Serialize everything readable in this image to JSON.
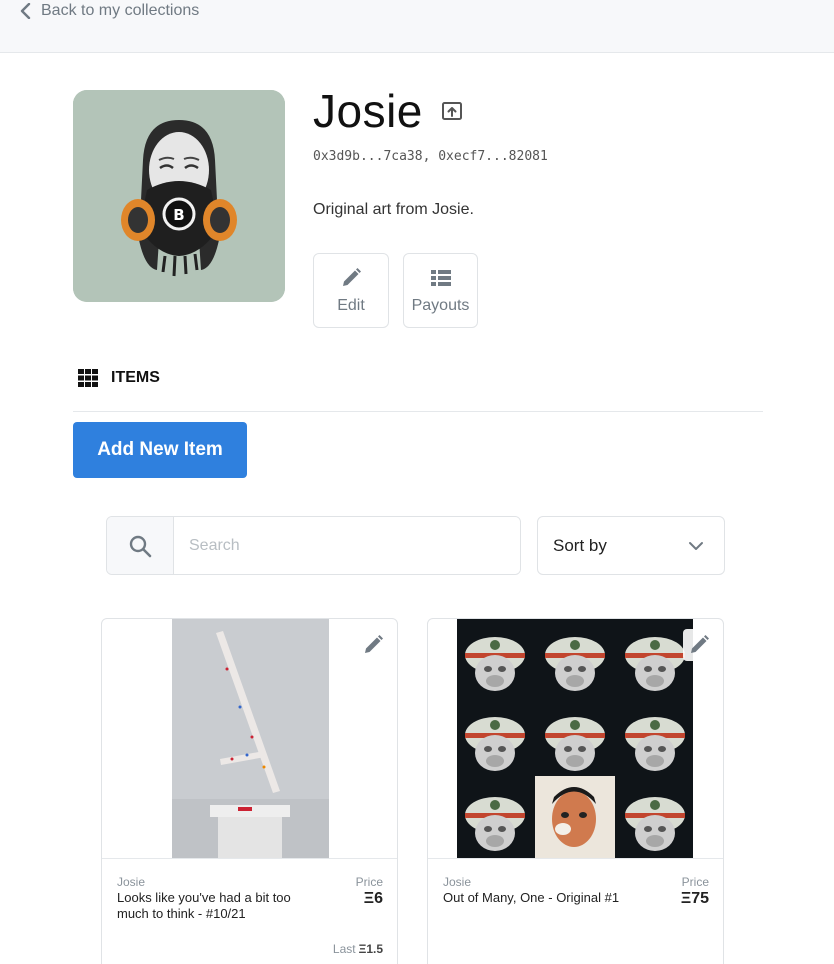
{
  "nav": {
    "back_label": "Back to my collections"
  },
  "collection": {
    "title": "Josie",
    "addresses": "0x3d9b...7ca38, 0xecf7...82081",
    "description": "Original art from Josie.",
    "actions": {
      "edit_label": "Edit",
      "payouts_label": "Payouts"
    }
  },
  "items_section": {
    "heading": "ITEMS",
    "add_button_label": "Add New Item"
  },
  "search": {
    "placeholder": "Search",
    "value": ""
  },
  "sort": {
    "label": "Sort by"
  },
  "cards": [
    {
      "creator": "Josie",
      "name": "Looks like you've had a bit too much to think - #10/21",
      "price_label": "Price",
      "price": "Ξ6",
      "last_label": "Last",
      "last_price": "Ξ1.5"
    },
    {
      "creator": "Josie",
      "name": "Out of Many, One - Original #1",
      "price_label": "Price",
      "price": "Ξ75"
    }
  ],
  "colors": {
    "accent": "#2f80de",
    "avatar_bg": "#b3c4b8"
  },
  "icons": [
    "chevron-left-icon",
    "open-link-icon",
    "pencil-icon",
    "list-icon",
    "grid-icon",
    "search-icon",
    "chevron-down-icon"
  ]
}
